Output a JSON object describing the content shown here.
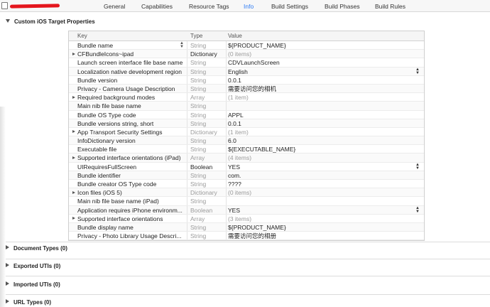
{
  "tabs": [
    {
      "label": "General",
      "active": false
    },
    {
      "label": "Capabilities",
      "active": false
    },
    {
      "label": "Resource Tags",
      "active": false
    },
    {
      "label": "Info",
      "active": true
    },
    {
      "label": "Build Settings",
      "active": false
    },
    {
      "label": "Build Phases",
      "active": false
    },
    {
      "label": "Build Rules",
      "active": false
    }
  ],
  "custom_properties": {
    "title": "Custom iOS Target Properties",
    "columns": {
      "key": "Key",
      "type": "Type",
      "value": "Value"
    },
    "rows": [
      {
        "key": "Bundle name",
        "type": "String",
        "value": "${PRODUCT_NAME}"
      },
      {
        "key": "CFBundleIcons~ipad",
        "type": "Dictionary",
        "value": "(0 items)"
      },
      {
        "key": "Launch screen interface file base name",
        "type": "String",
        "value": "CDVLaunchScreen"
      },
      {
        "key": "Localization native development region",
        "type": "String",
        "value": "English"
      },
      {
        "key": "Bundle version",
        "type": "String",
        "value": "0.0.1"
      },
      {
        "key": "Privacy - Camera Usage Description",
        "type": "String",
        "value": "需要访问您的相机"
      },
      {
        "key": "Required background modes",
        "type": "Array",
        "value": "(1 item)"
      },
      {
        "key": "Main nib file base name",
        "type": "String",
        "value": ""
      },
      {
        "key": "Bundle OS Type code",
        "type": "String",
        "value": "APPL"
      },
      {
        "key": "Bundle versions string, short",
        "type": "String",
        "value": "0.0.1"
      },
      {
        "key": "App Transport Security Settings",
        "type": "Dictionary",
        "value": "(1 item)"
      },
      {
        "key": "InfoDictionary version",
        "type": "String",
        "value": "6.0"
      },
      {
        "key": "Executable file",
        "type": "String",
        "value": "${EXECUTABLE_NAME}"
      },
      {
        "key": "Supported interface orientations (iPad)",
        "type": "Array",
        "value": "(4 items)"
      },
      {
        "key": "UIRequiresFullScreen",
        "type": "Boolean",
        "value": "YES"
      },
      {
        "key": "Bundle identifier",
        "type": "String",
        "value": "com."
      },
      {
        "key": "Bundle creator OS Type code",
        "type": "String",
        "value": "????"
      },
      {
        "key": "Icon files (iOS 5)",
        "type": "Dictionary",
        "value": "(0 items)"
      },
      {
        "key": "Main nib file base name (iPad)",
        "type": "String",
        "value": ""
      },
      {
        "key": "Application requires iPhone environm...",
        "type": "Boolean",
        "value": "YES"
      },
      {
        "key": "Supported interface orientations",
        "type": "Array",
        "value": "(3 items)"
      },
      {
        "key": "Bundle display name",
        "type": "String",
        "value": "${PRODUCT_NAME}"
      },
      {
        "key": "Privacy - Photo Library Usage Descri...",
        "type": "String",
        "value": "需要访问您的相册"
      }
    ]
  },
  "sections": [
    {
      "label": "Document Types (0)"
    },
    {
      "label": "Exported UTIs (0)"
    },
    {
      "label": "Imported UTIs (0)"
    },
    {
      "label": "URL Types (0)"
    }
  ],
  "colors": {
    "accent": "#2d7bf4",
    "redaction": "#e4161d"
  }
}
